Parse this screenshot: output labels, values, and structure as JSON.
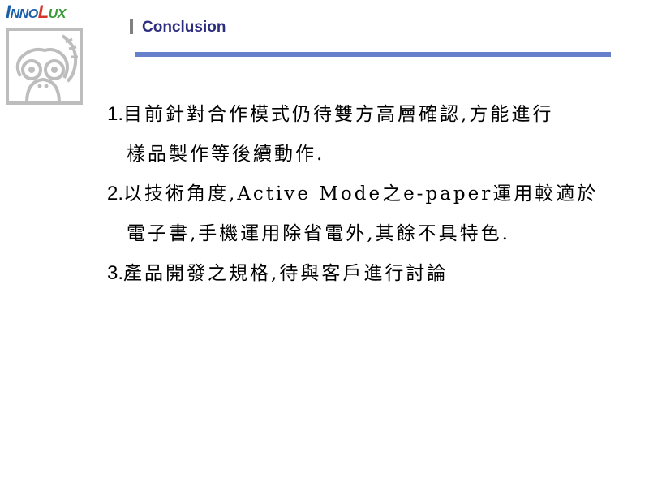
{
  "logo": {
    "text_parts": [
      {
        "text": "I",
        "color": "#1a5fa8",
        "size": "big"
      },
      {
        "text": "NNO",
        "color": "#1a5fa8",
        "size": "small"
      },
      {
        "text": "L",
        "color": "#d4342a",
        "size": "big"
      },
      {
        "text": "UX",
        "color": "#3a9a3a",
        "size": "small"
      }
    ],
    "mascot": "monkey-icon"
  },
  "header": {
    "title": "Conclusion",
    "title_color": "#2d2d80",
    "rule_color": "#6680cc",
    "marker_color": "#808080"
  },
  "items": [
    {
      "number": "1.",
      "lines": [
        "目前針對合作模式仍待雙方高層確認,方能進行",
        "樣品製作等後續動作."
      ]
    },
    {
      "number": "2.",
      "lines": [
        "以技術角度,Active Mode之e-paper運用較適於",
        "電子書,手機運用除省電外,其餘不具特色."
      ]
    },
    {
      "number": "3.",
      "lines": [
        "產品開發之規格,待與客戶進行討論"
      ]
    }
  ]
}
